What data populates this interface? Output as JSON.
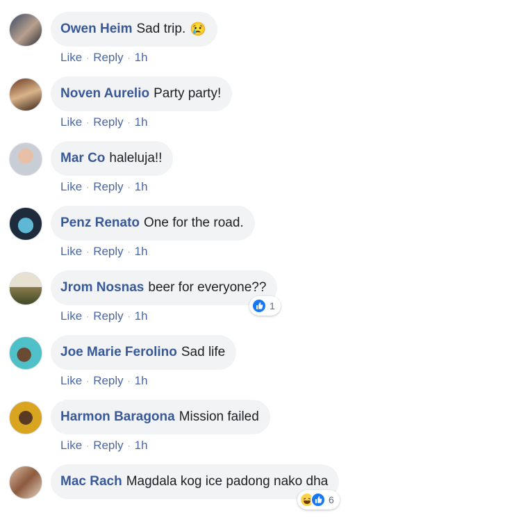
{
  "actions": {
    "like": "Like",
    "reply": "Reply",
    "sep": "·"
  },
  "colors": {
    "author": "#385898",
    "link": "#4b67a1",
    "bubble": "#f2f3f5",
    "like_blue": "#1877f2"
  },
  "comments": [
    {
      "author": "Owen Heim",
      "text": "Sad trip.",
      "emoji": "😢",
      "time": "1h"
    },
    {
      "author": "Noven Aurelio",
      "text": "Party party!",
      "time": "1h"
    },
    {
      "author": "Mar Co",
      "text": "haleluja!!",
      "time": "1h"
    },
    {
      "author": "Penz Renato",
      "text": "One for the road.",
      "time": "1h"
    },
    {
      "author": "Jrom Nosnas",
      "text": "beer for everyone??",
      "time": "1h",
      "reaction_count": "1",
      "reaction_icons": [
        "like-icon"
      ]
    },
    {
      "author": "Joe Marie Ferolino",
      "text": "Sad life",
      "time": "1h"
    },
    {
      "author": "Harmon Baragona",
      "text": "Mission failed",
      "time": "1h"
    },
    {
      "author": "Mac Rach",
      "text": "Magdala kog ice padong nako dha",
      "reaction_count": "6",
      "reaction_icons": [
        "haha-icon",
        "like-icon"
      ]
    }
  ]
}
